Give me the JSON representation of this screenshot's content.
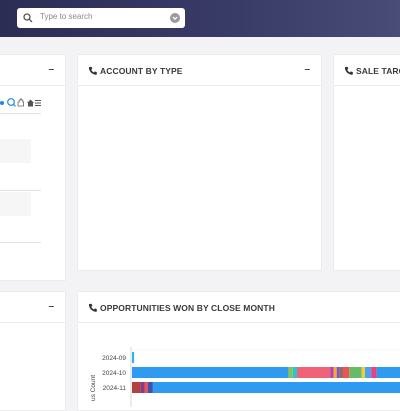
{
  "search": {
    "placeholder": "Type to search"
  },
  "cards": {
    "left_top": {
      "collapse_symbol": "–"
    },
    "account_by_type": {
      "title": "ACCOUNT BY TYPE",
      "collapse_symbol": "–"
    },
    "sale_target": {
      "title": "SALE TARG"
    },
    "left_bottom": {
      "collapse_symbol": "–"
    },
    "opps_won": {
      "title": "OPPORTUNITIES WON BY CLOSE MONTH",
      "y_axis_label": "us Count"
    }
  },
  "chart_data": {
    "type": "bar",
    "orientation": "horizontal",
    "stacked": true,
    "categories": [
      "2024-09",
      "2024-10",
      "2024-11"
    ],
    "ylabel": "us Count",
    "segments": [
      {
        "category": "2024-09",
        "parts": [
          {
            "color": "#29b6f6",
            "value": 2
          }
        ]
      },
      {
        "category": "2024-10",
        "parts": [
          {
            "color": "#2f9bf0",
            "value": 150
          },
          {
            "color": "#8bc34a",
            "value": 4
          },
          {
            "color": "#26c6da",
            "value": 4
          },
          {
            "color": "#f06277",
            "value": 32
          },
          {
            "color": "#ab47bc",
            "value": 3
          },
          {
            "color": "#ffa726",
            "value": 3
          },
          {
            "color": "#7e57c2",
            "value": 3
          },
          {
            "color": "#8d6e63",
            "value": 3
          },
          {
            "color": "#ef5350",
            "value": 6
          },
          {
            "color": "#66bb6a",
            "value": 12
          },
          {
            "color": "#ffca28",
            "value": 3
          },
          {
            "color": "#42a5f5",
            "value": 6
          },
          {
            "color": "#ec407a",
            "value": 5
          },
          {
            "color": "#2f9bf0",
            "value": 36
          }
        ]
      },
      {
        "category": "2024-11",
        "parts": [
          {
            "color": "#b0413e",
            "value": 8
          },
          {
            "color": "#8e3a80",
            "value": 4
          },
          {
            "color": "#ef5350",
            "value": 3
          },
          {
            "color": "#3f51b5",
            "value": 5
          },
          {
            "color": "#2f9bf0",
            "value": 250
          }
        ]
      }
    ],
    "x_max": 270
  }
}
